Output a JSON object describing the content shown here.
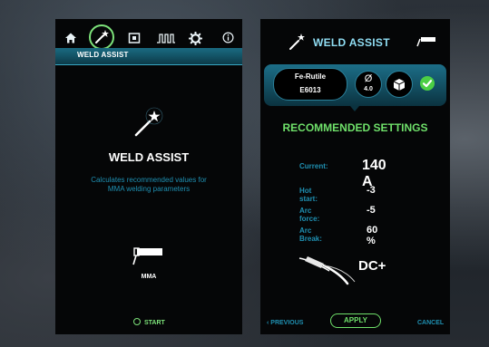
{
  "left_panel": {
    "tab_label": "WELD ASSIST",
    "title": "WELD ASSIST",
    "description": "Calculates recommended values for MMA welding parameters",
    "process_label": "MMA",
    "start_label": "START",
    "nav_icons": [
      "home-icon",
      "weld-assist-icon",
      "memory-icon",
      "pulse-wave-icon",
      "settings-gear-icon",
      "info-icon"
    ]
  },
  "right_panel": {
    "title": "WELD ASSIST",
    "electrode_type": "Fe-Rutile",
    "electrode_code": "E6013",
    "diameter_symbol": "Ø",
    "diameter_value": "4.0",
    "recommended_title": "RECOMMENDED SETTINGS",
    "settings": [
      {
        "label": "Current:",
        "value": "140 A"
      },
      {
        "label": "Hot start:",
        "value": "-3"
      },
      {
        "label": "Arc force:",
        "value": "-5"
      },
      {
        "label": "Arc Break:",
        "value": "60 %"
      }
    ],
    "polarity": "DC+",
    "previous_label": "PREVIOUS",
    "apply_label": "APPLY",
    "cancel_label": "CANCEL"
  },
  "colors": {
    "accent_blue": "#1f90b2",
    "title_blue": "#8fdcf2",
    "accent_green": "#6fe06a",
    "panel_bg": "#050607"
  }
}
